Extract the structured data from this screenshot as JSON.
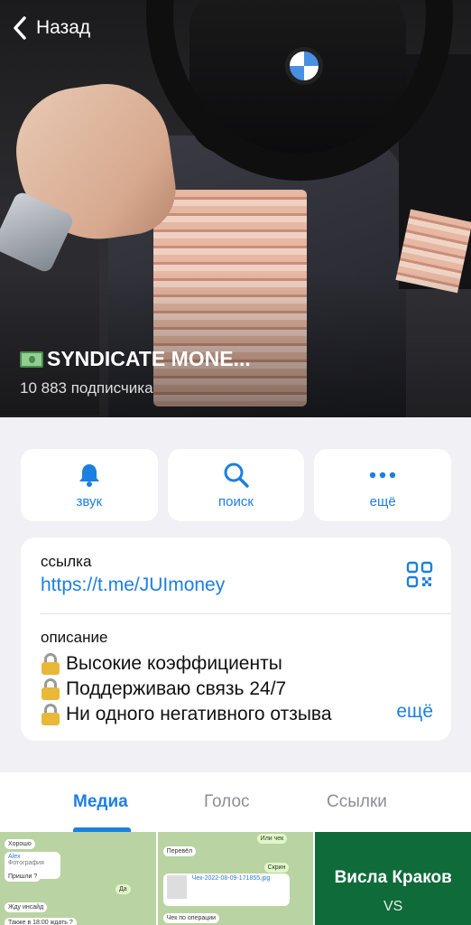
{
  "header": {
    "back_label": "Назад",
    "channel_title": "SYNDICATE MONE...",
    "subscribers": "10 883 подписчика"
  },
  "actions": [
    {
      "label": "звук",
      "icon": "bell-icon"
    },
    {
      "label": "поиск",
      "icon": "search-icon"
    },
    {
      "label": "ещё",
      "icon": "more-dots-icon"
    }
  ],
  "info": {
    "link_caption": "ссылка",
    "link": "https://t.me/JUImoney",
    "description_caption": "описание",
    "description_lines": [
      "Высокие коэффициенты",
      "Поддерживаю связь 24/7",
      "Ни одного негативного отзыва"
    ],
    "more_label": "ещё"
  },
  "tabs": [
    {
      "label": "Медиа",
      "active": true
    },
    {
      "label": "Голос",
      "active": false
    },
    {
      "label": "Ссылки",
      "active": false
    }
  ],
  "media": {
    "thumb1": [
      "Хорошо",
      "Alex",
      "Фотография",
      "Пришли ?",
      "Да",
      "Жду инсайд",
      "Также в 18:00 ждать ?"
    ],
    "thumb2": [
      "Или чек",
      "Перевёл",
      "Скрин",
      "Чек-2022-08-09-171855.jpg",
      "Чек по операции"
    ],
    "thumb3_title": "Висла Краков",
    "thumb3_sub": "VS"
  },
  "colors": {
    "accent": "#1d7fe0",
    "background": "#f0f0f5"
  }
}
